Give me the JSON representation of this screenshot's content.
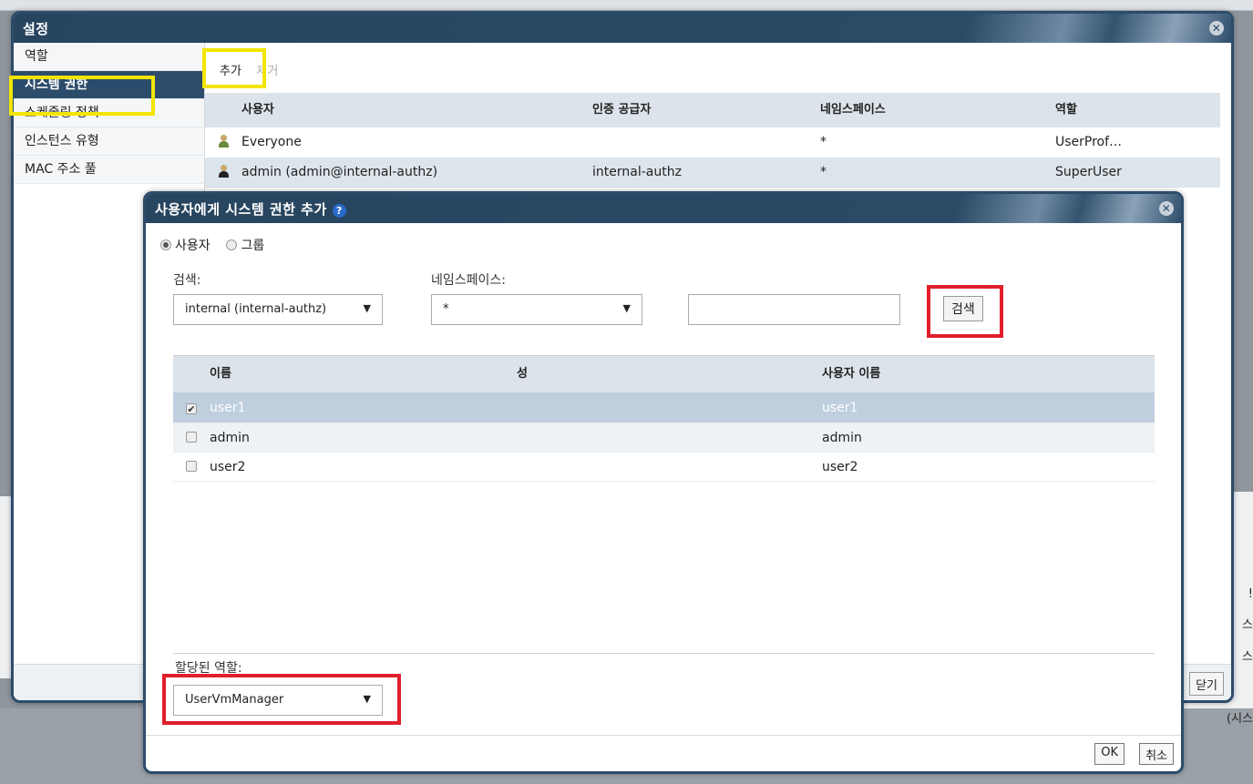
{
  "background": {
    "right_labels": [
      "!",
      "스",
      "스"
    ],
    "close_label": "닫기",
    "status_fragment": "(시스"
  },
  "settings": {
    "title": "설정",
    "sidebar": [
      {
        "label": "역할"
      },
      {
        "label": "시스템 권한"
      },
      {
        "label": "스케줄링 정책"
      },
      {
        "label": "인스턴스 유형"
      },
      {
        "label": "MAC 주소 풀"
      }
    ],
    "toolbar": {
      "add": "추가",
      "remove": "제거"
    },
    "columns": [
      "사용자",
      "인증 공급자",
      "네임스페이스",
      "역할"
    ],
    "rows": [
      {
        "user": "Everyone",
        "provider": "",
        "namespace": "*",
        "role": "UserProf…",
        "icon": "user-icon"
      },
      {
        "user": "admin (admin@internal-authz)",
        "provider": "internal-authz",
        "namespace": "*",
        "role": "SuperUser",
        "icon": "admin-user-icon"
      }
    ]
  },
  "add_permission": {
    "title": "사용자에게 시스템 권한 추가",
    "radio_user": "사용자",
    "radio_group": "그룹",
    "search_label": "검색:",
    "namespace_label": "네임스페이스:",
    "search_select": "internal (internal-authz)",
    "namespace_select": "*",
    "search_input": "",
    "search_button": "검색",
    "columns": [
      "이름",
      "성",
      "사용자 이름"
    ],
    "rows": [
      {
        "first": "user1",
        "last": "",
        "username": "user1",
        "checked": true
      },
      {
        "first": "admin",
        "last": "",
        "username": "admin",
        "checked": false
      },
      {
        "first": "user2",
        "last": "",
        "username": "user2",
        "checked": false
      }
    ],
    "role_label": "할당된 역할:",
    "role_select": "UserVmManager",
    "ok": "OK",
    "cancel": "취소"
  },
  "colors": {
    "title_bar": "#2c4c6b",
    "highlight_red": "#e01f2d",
    "highlight_yellow": "#f2e600",
    "selected_row": "#bfcfde"
  }
}
